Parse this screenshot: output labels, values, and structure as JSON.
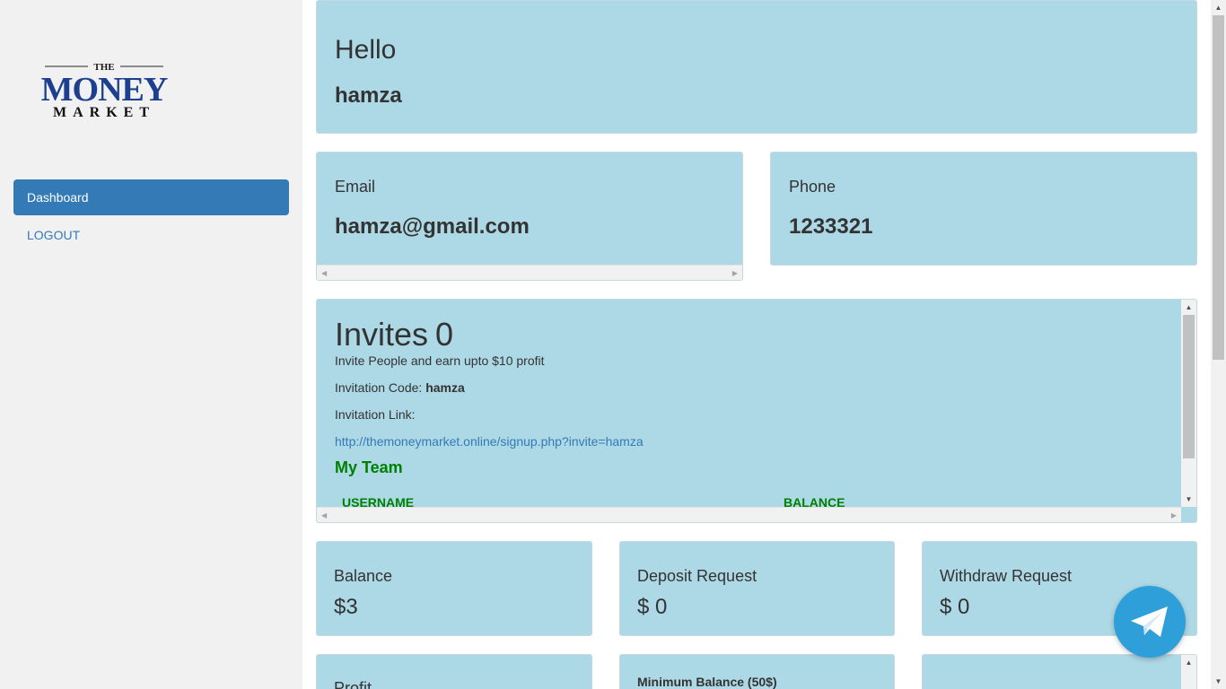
{
  "brand": {
    "logo_line1": "THE",
    "logo_line2": "MONEY",
    "logo_line3": "MARKET"
  },
  "sidebar": {
    "items": [
      {
        "label": "Dashboard",
        "active": true
      },
      {
        "label": "LOGOUT",
        "active": false
      }
    ]
  },
  "greeting": {
    "title": "Hello",
    "name": "hamza"
  },
  "email": {
    "label": "Email",
    "value": "hamza@gmail.com"
  },
  "phone": {
    "label": "Phone",
    "value": "1233321"
  },
  "invites": {
    "title": "Invites",
    "count": "0",
    "subtitle": "Invite People and earn upto $10 profit",
    "code_label": "Invitation Code:",
    "code_value": "hamza",
    "link_label": "Invitation Link:",
    "link_value": "http://themoneymarket.online/signup.php?invite=hamza",
    "team_title": "My Team",
    "columns": [
      "USERNAME",
      "BALANCE"
    ]
  },
  "stats": [
    {
      "label": "Balance",
      "value": "$3"
    },
    {
      "label": "Deposit Request",
      "value": "$ 0"
    },
    {
      "label": "Withdraw Request",
      "value": "$ 0"
    }
  ],
  "bottom": {
    "profit_label": "Profit",
    "min_balance_label": "Minimum Balance (50$)"
  },
  "colors": {
    "card_bg": "#add8e6",
    "sidebar_bg": "#f1f1f1",
    "accent": "#337ab7",
    "team_green": "#008000",
    "telegram": "#2f9fd9"
  },
  "icons": [
    "telegram-icon"
  ]
}
